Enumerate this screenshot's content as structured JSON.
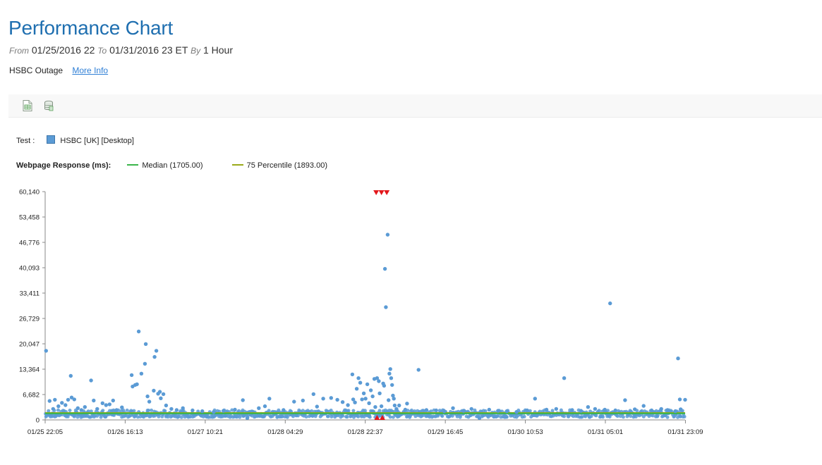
{
  "header": {
    "title": "Performance Chart",
    "from_label": "From",
    "from_value": "01/25/2016 22",
    "to_label": "To",
    "to_value": "01/31/2016 23 ET",
    "by_label": "By",
    "by_value": "1 Hour"
  },
  "note": {
    "text": "HSBC Outage",
    "link_label": "More Info"
  },
  "toolbar": {
    "icons": [
      "excel-export-icon",
      "database-icon"
    ]
  },
  "colors": {
    "points": "#5b9bd5",
    "median": "#3ab54a",
    "percentile": "#9aaa1a",
    "error_marker": "#e3181c",
    "axis": "#888888"
  },
  "chart_data": {
    "type": "scatter",
    "test_label": "Test :",
    "test_name": "HSBC [UK] [Desktop]",
    "metric_label": "Webpage Response (ms):",
    "ylim": [
      0,
      60140
    ],
    "yticks": [
      "0",
      "6,682",
      "13,364",
      "20,047",
      "26,729",
      "33,411",
      "40,093",
      "46,776",
      "53,458",
      "60,140"
    ],
    "xlim_hours": [
      0,
      145
    ],
    "xticks": [
      {
        "label": "01/25 22:05",
        "h": 0
      },
      {
        "label": "01/26 16:13",
        "h": 18.13
      },
      {
        "label": "01/27 10:21",
        "h": 36.27
      },
      {
        "label": "01/28 04:29",
        "h": 54.4
      },
      {
        "label": "01/28 22:37",
        "h": 72.53
      },
      {
        "label": "01/29 16:45",
        "h": 90.67
      },
      {
        "label": "01/30 10:53",
        "h": 108.8
      },
      {
        "label": "01/31 05:01",
        "h": 126.93
      },
      {
        "label": "01/31 23:09",
        "h": 145.07
      }
    ],
    "series": [
      {
        "name": "Median (1705.00)",
        "kind": "reference-line",
        "value": 1705
      },
      {
        "name": "75 Percentile (1893.00)",
        "kind": "reference-line",
        "value": 1893
      }
    ],
    "error_markers": {
      "top_hours": [
        75.0,
        76.2,
        77.4
      ],
      "bottom_hours": [
        75.2,
        76.4
      ]
    },
    "points": [
      [
        0.2,
        18200
      ],
      [
        1.0,
        5000
      ],
      [
        1.8,
        2900
      ],
      [
        2.2,
        5300
      ],
      [
        3.0,
        3600
      ],
      [
        3.8,
        4500
      ],
      [
        4.6,
        3900
      ],
      [
        5.2,
        5300
      ],
      [
        5.8,
        11600
      ],
      [
        6.0,
        5900
      ],
      [
        6.6,
        5400
      ],
      [
        7.4,
        3100
      ],
      [
        8.2,
        2600
      ],
      [
        9.0,
        3400
      ],
      [
        10.4,
        10400
      ],
      [
        11.0,
        5100
      ],
      [
        11.8,
        2900
      ],
      [
        13.0,
        4400
      ],
      [
        13.8,
        3900
      ],
      [
        14.6,
        4100
      ],
      [
        15.4,
        5100
      ],
      [
        16.2,
        2600
      ],
      [
        17.4,
        3300
      ],
      [
        19.6,
        11800
      ],
      [
        19.8,
        8800
      ],
      [
        20.4,
        9200
      ],
      [
        20.8,
        9400
      ],
      [
        21.2,
        23300
      ],
      [
        21.8,
        12200
      ],
      [
        22.6,
        14800
      ],
      [
        22.8,
        20000
      ],
      [
        23.2,
        6200
      ],
      [
        23.6,
        4800
      ],
      [
        24.6,
        7700
      ],
      [
        24.8,
        16600
      ],
      [
        25.2,
        18200
      ],
      [
        25.6,
        6900
      ],
      [
        26.0,
        7400
      ],
      [
        26.2,
        5700
      ],
      [
        26.8,
        6800
      ],
      [
        27.4,
        3800
      ],
      [
        28.6,
        2900
      ],
      [
        29.8,
        2600
      ],
      [
        31.2,
        3100
      ],
      [
        33.4,
        2500
      ],
      [
        35.6,
        2300
      ],
      [
        38.2,
        2100
      ],
      [
        40.4,
        2400
      ],
      [
        43.0,
        2700
      ],
      [
        44.8,
        5200
      ],
      [
        45.8,
        500
      ],
      [
        48.4,
        3100
      ],
      [
        49.8,
        3600
      ],
      [
        50.8,
        5600
      ],
      [
        54.0,
        2600
      ],
      [
        56.4,
        4800
      ],
      [
        58.4,
        5100
      ],
      [
        60.8,
        6800
      ],
      [
        61.6,
        3500
      ],
      [
        63.0,
        5600
      ],
      [
        64.8,
        5800
      ],
      [
        66.2,
        5300
      ],
      [
        67.4,
        4700
      ],
      [
        68.6,
        3900
      ],
      [
        69.6,
        12000
      ],
      [
        69.8,
        5400
      ],
      [
        70.2,
        4600
      ],
      [
        70.6,
        8200
      ],
      [
        71.0,
        11000
      ],
      [
        71.4,
        9800
      ],
      [
        71.8,
        5400
      ],
      [
        72.2,
        7000
      ],
      [
        72.6,
        5600
      ],
      [
        73.0,
        9400
      ],
      [
        73.4,
        4400
      ],
      [
        73.8,
        7800
      ],
      [
        74.2,
        6200
      ],
      [
        74.6,
        10800
      ],
      [
        74.8,
        3400
      ],
      [
        75.2,
        11000
      ],
      [
        75.6,
        10200
      ],
      [
        75.8,
        7000
      ],
      [
        76.2,
        3600
      ],
      [
        76.6,
        9600
      ],
      [
        76.8,
        9000
      ],
      [
        77.0,
        39800
      ],
      [
        77.2,
        29700
      ],
      [
        77.6,
        48800
      ],
      [
        77.8,
        5200
      ],
      [
        78.0,
        12200
      ],
      [
        78.2,
        13400
      ],
      [
        78.4,
        11000
      ],
      [
        78.6,
        9200
      ],
      [
        78.8,
        6400
      ],
      [
        79.0,
        5600
      ],
      [
        79.2,
        3800
      ],
      [
        79.6,
        2900
      ],
      [
        80.2,
        3800
      ],
      [
        81.6,
        2700
      ],
      [
        82.0,
        4300
      ],
      [
        84.6,
        13200
      ],
      [
        86.4,
        2600
      ],
      [
        88.6,
        2500
      ],
      [
        90.4,
        2300
      ],
      [
        92.4,
        3100
      ],
      [
        94.8,
        2400
      ],
      [
        96.6,
        2900
      ],
      [
        98.4,
        500
      ],
      [
        100.6,
        2700
      ],
      [
        102.6,
        2400
      ],
      [
        104.6,
        2300
      ],
      [
        106.8,
        2100
      ],
      [
        109.2,
        2500
      ],
      [
        111.0,
        5600
      ],
      [
        113.6,
        2700
      ],
      [
        115.8,
        2900
      ],
      [
        117.6,
        11000
      ],
      [
        119.4,
        2600
      ],
      [
        121.4,
        2400
      ],
      [
        123.0,
        3400
      ],
      [
        124.6,
        2900
      ],
      [
        126.8,
        2700
      ],
      [
        128.0,
        30700
      ],
      [
        129.2,
        2500
      ],
      [
        131.4,
        5200
      ],
      [
        133.6,
        2800
      ],
      [
        135.6,
        3700
      ],
      [
        137.4,
        2500
      ],
      [
        139.6,
        2900
      ],
      [
        141.0,
        2600
      ],
      [
        142.8,
        2300
      ],
      [
        143.4,
        16200
      ],
      [
        143.8,
        5400
      ],
      [
        144.0,
        2800
      ],
      [
        145.0,
        5300
      ]
    ],
    "baseline_band": {
      "low": 700,
      "high": 2600
    }
  }
}
